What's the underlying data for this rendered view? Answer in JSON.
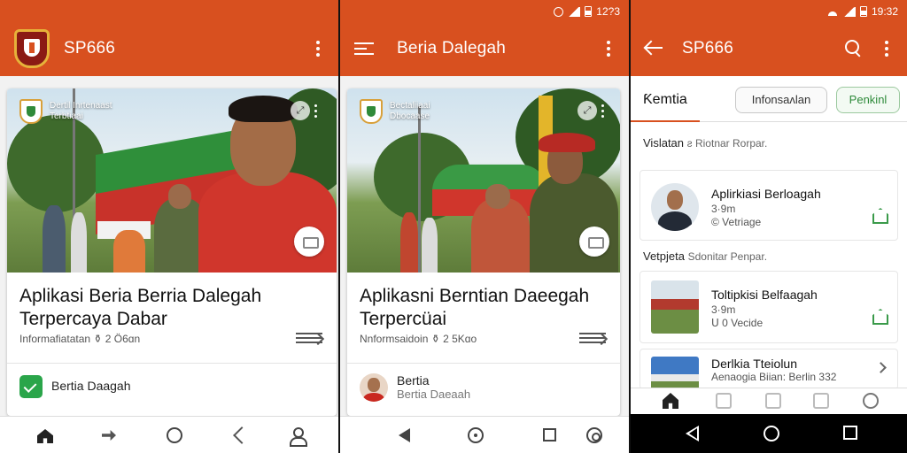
{
  "colors": {
    "brand": "#d8501f",
    "accent_green": "#2aa54a",
    "text": "#111111"
  },
  "panel1": {
    "app_title": "SP666",
    "card": {
      "overlay_text_line1": "Dertil Inrtenaast",
      "overlay_text_line2": "Terbtiaai",
      "headline_line1": "Aplikasi Beria Berria Dalegah",
      "headline_line2": "Terpercaya Dabar",
      "meta": "Informafiatatan ⚱ 2 Ö6ɑn",
      "source": "Bertia Daagah"
    },
    "nav_icons": [
      "home-icon",
      "forward-icon",
      "circle-icon",
      "share-icon",
      "profile-icon"
    ]
  },
  "panel2": {
    "status_time": "12?3",
    "app_title": "Beria Dalegah",
    "card": {
      "overlay_text_line1": "Bectaliiaai",
      "overlay_text_line2": "Dbocaase",
      "headline_line1": "Aplikasni Berntian Daeegah",
      "headline_line2": "Terpercüai",
      "meta": "Nnformsaidoin ⚱ 2 5Kɑo",
      "source_name": "Bertia",
      "source_sub": "Bertia Daeaah"
    }
  },
  "panel3": {
    "status_time": "19:32",
    "app_title": "SP666",
    "tabs": {
      "active": "Ƙemtia",
      "chip1": "Infonsaʌlan",
      "chip2": "Penkinl"
    },
    "section1": {
      "title": "Vislatan",
      "muted": "ƨ Riotnar Rorpar."
    },
    "item1": {
      "title": "Aplirkiasi Berloagah",
      "sub1": "3·9m",
      "sub2": "© Vetriage"
    },
    "section2": {
      "title": "Vetpjeta",
      "muted": "Sdonitar Penpar."
    },
    "item2": {
      "title": "Toltipkisi Belfaagah",
      "sub1": "3·9m",
      "sub2": "ᑌ 0 Vecide"
    },
    "item3": {
      "title": "Derlkia Tteiolun",
      "sub": "Aenaogia Biian: Berlin   332"
    }
  }
}
